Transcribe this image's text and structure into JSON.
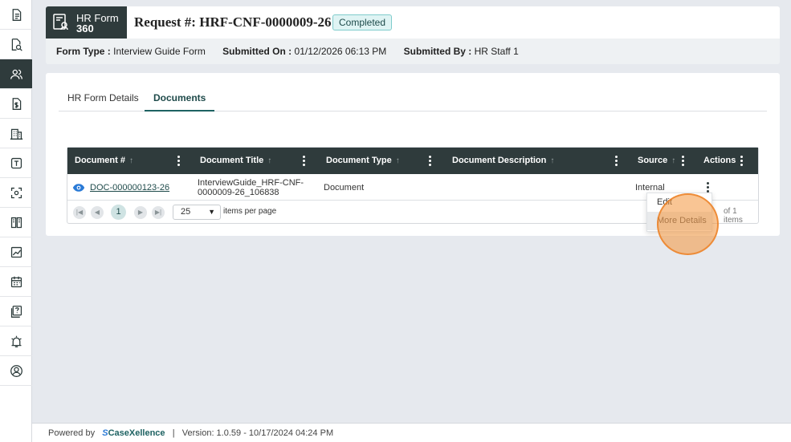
{
  "app": {
    "logo_line1": "HR Form",
    "logo_line2": "360"
  },
  "request": {
    "label": "Request #:",
    "number": "HRF-CNF-0000009-26",
    "status": "Completed",
    "form_type_label": "Form Type :",
    "form_type": "Interview Guide Form",
    "submitted_on_label": "Submitted On :",
    "submitted_on": "01/12/2026 06:13 PM",
    "submitted_by_label": "Submitted By :",
    "submitted_by": "HR Staff 1"
  },
  "sidebar": {
    "items": [
      {
        "icon": "document-icon"
      },
      {
        "icon": "search-document-icon"
      },
      {
        "icon": "users-icon",
        "active": true
      },
      {
        "icon": "dollar-document-icon"
      },
      {
        "icon": "building-icon"
      },
      {
        "icon": "text-box-icon"
      },
      {
        "icon": "scan-icon"
      },
      {
        "icon": "book-icon"
      },
      {
        "icon": "chart-icon"
      },
      {
        "icon": "calendar-icon"
      },
      {
        "icon": "help-pages-icon"
      },
      {
        "icon": "alarm-icon"
      },
      {
        "icon": "user-circle-icon"
      }
    ]
  },
  "tabs": {
    "details": "HR Form Details",
    "documents": "Documents"
  },
  "grid": {
    "columns": {
      "doc_num": "Document #",
      "doc_title": "Document Title",
      "doc_type": "Document Type",
      "doc_desc": "Document Description",
      "source": "Source",
      "actions": "Actions"
    },
    "rows": [
      {
        "doc_num": "DOC-000000123-26",
        "title_line1": "InterviewGuide_HRF-CNF-",
        "title_line2": "0000009-26_106838",
        "doc_type": "Document",
        "doc_desc": "",
        "source": "Internal"
      }
    ],
    "pager": {
      "current_page": "1",
      "page_size": "25",
      "per_page_label": "items per page",
      "info": "of 1 items"
    },
    "row_menu": {
      "edit": "Edit",
      "more_details": "More Details"
    }
  },
  "footer": {
    "powered_by": "Powered by",
    "brand_s": "S",
    "brand": "CaseXellence",
    "separator": "|",
    "version": "Version: 1.0.59 - 10/17/2024 04:24 PM"
  },
  "colors": {
    "sidebar_active": "#2f3b3c",
    "accent": "#1e6262",
    "status_badge_bg": "#dff4f4"
  }
}
